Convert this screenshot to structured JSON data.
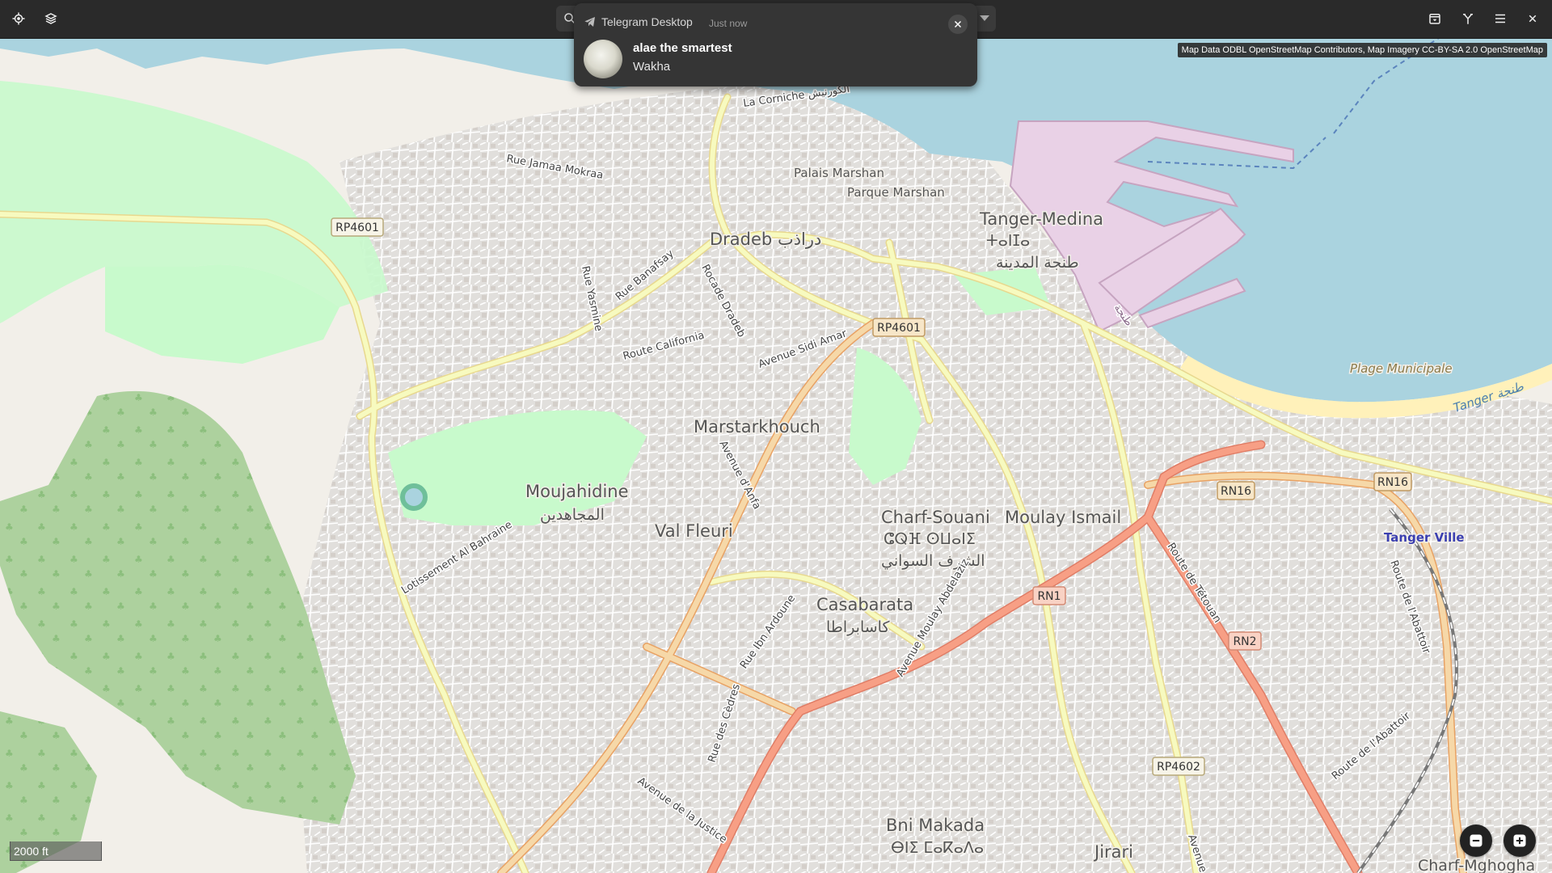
{
  "header": {
    "search_placeholder": "",
    "buttons": [
      "locate-icon",
      "layers-icon",
      "favorites-icon",
      "directions-icon",
      "menu-icon",
      "close-icon"
    ]
  },
  "notification": {
    "app_name": "Telegram Desktop",
    "time": "Just now",
    "sender": "alae the smartest",
    "message": "Wakha"
  },
  "map": {
    "attribution": "Map Data ODBL OpenStreetMap Contributors, Map Imagery CC-BY-SA 2.0 OpenStreetMap",
    "scale": "2000 ft",
    "colors": {
      "sea": "#aad3df",
      "land": "#f2efe9",
      "urban": "#e0dfdf",
      "park": "#c8facc",
      "forest": "#add19e",
      "primary": "#f6d8a8",
      "trunk": "#f79f85",
      "secondary": "#f7fabf",
      "port": "#e9d1e6",
      "beach": "#fff1ba"
    },
    "places": {
      "dradeb": "Dradeb دراذب",
      "tanger_medina": "Tanger-Medina",
      "tanger_medina_tif": "ⵜⴰⵏⵊⴰ",
      "tanger_medina_ar": "طنجة المدينة",
      "palais_marshan": "Palais Marshan",
      "parque_marshan": "Parque Marshan",
      "marstarkhouch": "Marstarkhouch",
      "moujahidine": "Moujahidine",
      "moujahidine_ar": "المجاهدين",
      "val_fleuri": "Val Fleuri",
      "charf_souani": "Charf-Souani",
      "charf_souani_tif": "ⵛⵕⴼ ⵙⵡⴰⵏⵉ",
      "charf_souani_ar": "الشرف السواني",
      "moulay_ismail": "Moulay Ismail",
      "casabarata": "Casabarata",
      "casabarata_ar": "كاسابراطا",
      "bni_makada": "Bni Makada",
      "bni_makada_tif": "ⴱⵏⵉ ⵎⴰⴽⴰⴷⴰ",
      "jirari": "Jirari",
      "tanger_ville": "Tanger Ville",
      "charf_mghogha": "Charf-Mghogha",
      "plage_municipale": "Plage Municipale",
      "tanger_bay": "Tanger طنجة"
    },
    "streets": {
      "rue_jamaa_mokraa": "Rue Jamaa Mokraa",
      "la_corniche": "La Corniche الكورنيش",
      "rue_banafsay": "Rue Banafsay",
      "rue_yasmine": "Rue Yasmine",
      "rocade_dradeb": "Rocade Dradeb",
      "route_california": "Route California",
      "avenue_sidi_amar": "Avenue Sidi Amar",
      "avenue_d_anfa": "Avenue d'Anfa",
      "lotissement_al_bahraine": "Lotissement Al Bahraine",
      "rue_ibn_ardoune": "Rue Ibn Ardoune",
      "avenue_moulay_abdelaziz": "Avenue Moulay Abdelaziz",
      "route_de_tetouan": "Route de Tétouan",
      "route_de_l_abattoir": "Route de l'Abattoir",
      "route_de_l_abattoir_2": "Route de l'Abattoir",
      "rue_des_cedres": "Rue des Cèdres",
      "avenue_de_la_justice": "Avenue de la Justice",
      "avenue_short": "Avenue",
      "port_label": "طنجة"
    },
    "shields": {
      "rp4601_a": "RP4601",
      "rp4601_b": "RP4601",
      "rn16_a": "RN16",
      "rn16_b": "RN16",
      "rn1": "RN1",
      "rn2": "RN2",
      "rp4602": "RP4602"
    }
  }
}
